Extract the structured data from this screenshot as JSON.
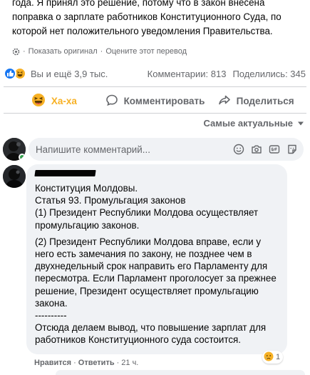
{
  "post": {
    "text": "года. Я принял это решение, потому что в закон внесена поправка о зарплате работников Конституционного Суда, по которой нет положительного уведомления Правительства.",
    "show_original": "Показать оригинал",
    "rate_translation": "Оцените этот перевод"
  },
  "stats": {
    "reactions_text": "Вы и ещё 3,9 тыс.",
    "comments": "Комментарии: 813",
    "shares": "Поделились: 345"
  },
  "actions": {
    "haha": "Ха-ха",
    "comment": "Комментировать",
    "share": "Поделиться"
  },
  "sort": {
    "label": "Самые актуальные"
  },
  "composer": {
    "placeholder": "Напишите комментарий..."
  },
  "comment": {
    "lines": [
      "Конституция Молдовы.",
      "Статья 93. Промульгация законов",
      "(1) Президент Республики Молдова осуществляет промульгацию законов.",
      "(2) Президент Республики Молдова вправе, если у него есть замечания по закону, не позднее чем в двухнедельный срок направить его Парламенту для пересмотра. Если Парламент проголосует за прежнее решение, Президент осуществляет промульгацию закона.",
      "----------",
      "Отсюда делаем вывод, что повышение зарплат для работников Конституционного суда состоится."
    ],
    "reaction_count": "1",
    "like": "Нравится",
    "reply": "Ответить",
    "time": "21 ч."
  },
  "colors": {
    "accent": "#1877f2",
    "haha": "#f7b125",
    "muted": "#65676b",
    "bubble": "#f0f2f5"
  }
}
